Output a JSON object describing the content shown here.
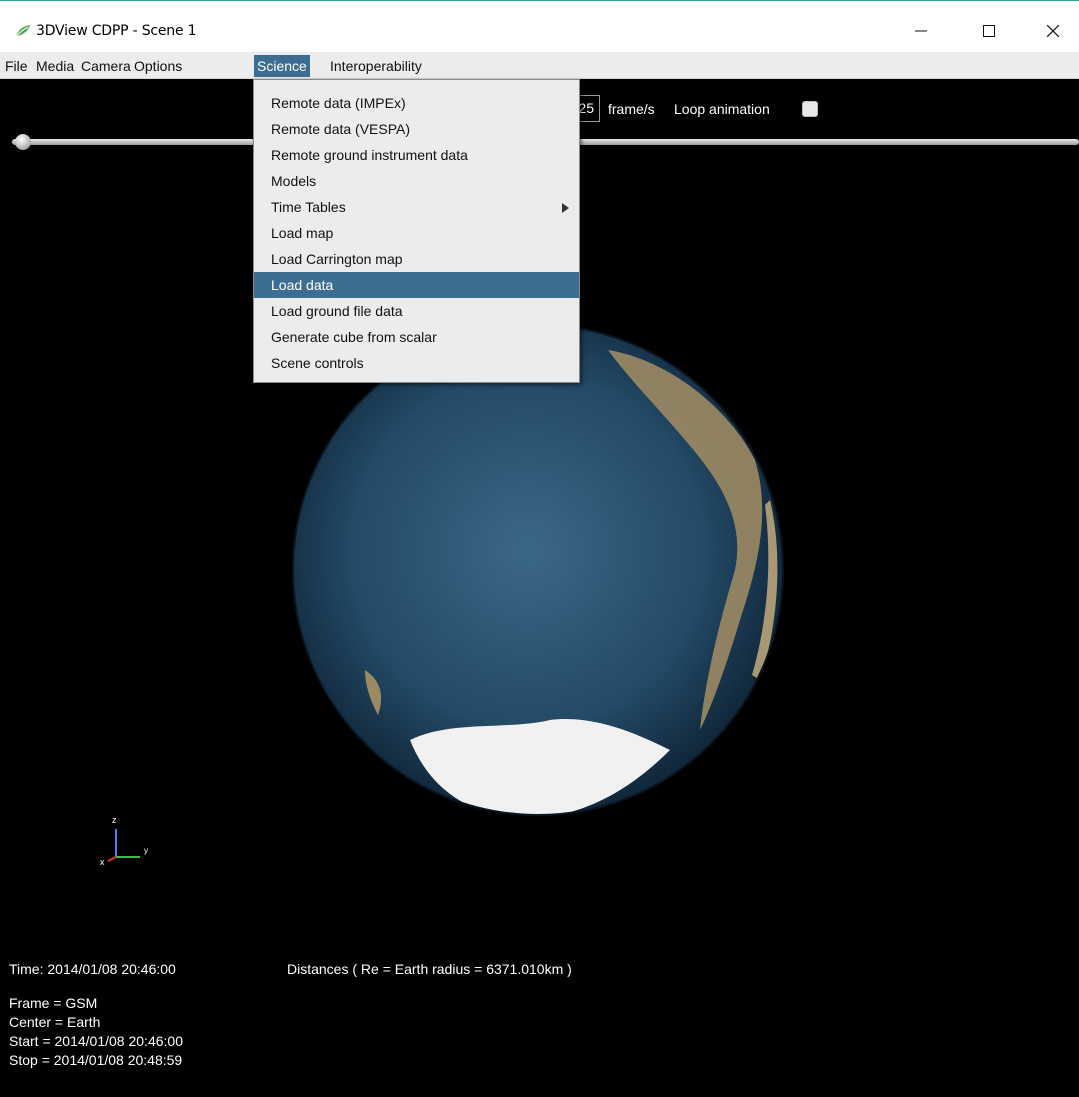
{
  "window": {
    "title": "3DView CDPP - Scene 1",
    "icons": {
      "app": "leaf-icon",
      "minimize": "minimize-icon",
      "maximize": "maximize-icon",
      "close": "close-icon"
    }
  },
  "menubar": {
    "items": [
      {
        "label": "File",
        "active": false
      },
      {
        "label": "Media",
        "active": false
      },
      {
        "label": "Camera",
        "active": false
      },
      {
        "label": "Options",
        "active": false
      },
      {
        "label": "Science",
        "active": true
      },
      {
        "label": "Interoperability",
        "active": false
      }
    ]
  },
  "science_menu": {
    "items": [
      {
        "label": "Remote data (IMPEx)"
      },
      {
        "label": "Remote data (VESPA)"
      },
      {
        "label": "Remote ground instrument data"
      },
      {
        "label": "Models"
      },
      {
        "label": "Time Tables",
        "submenu": true
      },
      {
        "label": "Load map"
      },
      {
        "label": "Load Carrington map"
      },
      {
        "label": "Load data",
        "highlighted": true
      },
      {
        "label": "Load ground file data"
      },
      {
        "label": "Generate cube from scalar"
      },
      {
        "label": "Scene controls"
      }
    ]
  },
  "animation": {
    "speed_value": "25",
    "speed_unit": "frame/s",
    "loop_label": "Loop animation",
    "loop_checked": false,
    "slider_position": 0
  },
  "axes": {
    "z": "z",
    "x": "x",
    "y": "y"
  },
  "info": {
    "time": "Time: 2014/01/08 20:46:00",
    "distances": "Distances ( Re = Earth radius = 6371.010km )",
    "frame": "Frame = GSM",
    "center": "Center = Earth",
    "start": "Start = 2014/01/08 20:46:00",
    "stop": "Stop = 2014/01/08 20:48:59"
  },
  "colors": {
    "menu_highlight": "#3d6d91",
    "menu_background": "#ececec",
    "viewport_background": "#000000",
    "ocean": "#254d6b",
    "land": "#9c8a63",
    "ice": "#f1f1f1"
  }
}
